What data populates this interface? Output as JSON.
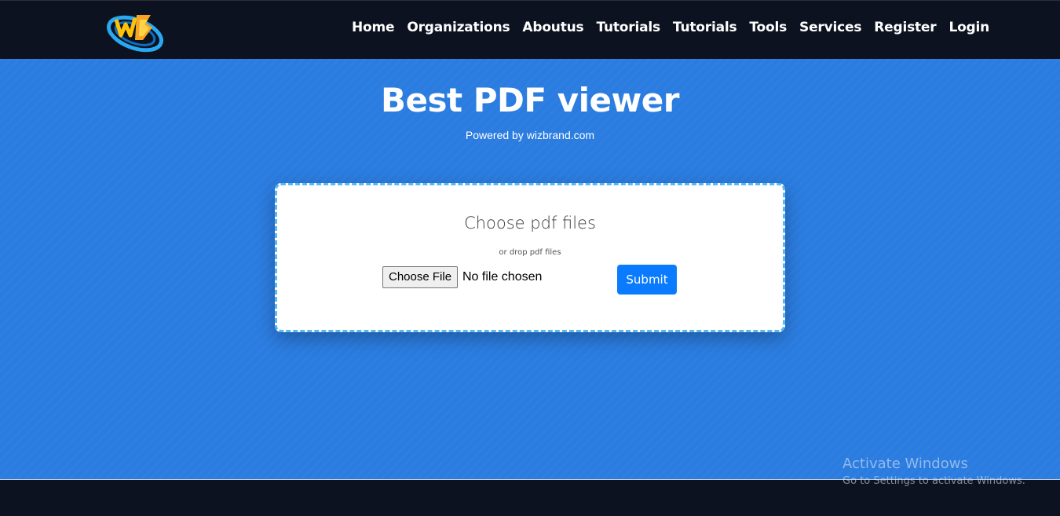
{
  "nav": {
    "logo_alt": "WB",
    "links": [
      "Home",
      "Organizations",
      "Aboutus",
      "Tutorials",
      "Tutorials",
      "Tools",
      "Services",
      "Register",
      "Login"
    ]
  },
  "hero": {
    "title": "Best PDF viewer",
    "subtitle": "Powered by wizbrand.com"
  },
  "upload": {
    "title": "Choose pdf files",
    "hint": "or drop pdf files",
    "file_button": "Choose File",
    "file_status": "No file chosen",
    "submit_label": "Submit"
  },
  "watermark": {
    "title": "Activate Windows",
    "subtitle": "Go to Settings to activate Windows."
  },
  "colors": {
    "nav_bg": "#0d1220",
    "hero_bg": "#2a7ce0",
    "card_border": "#58b8f0",
    "submit_bg": "#0a7bff"
  }
}
